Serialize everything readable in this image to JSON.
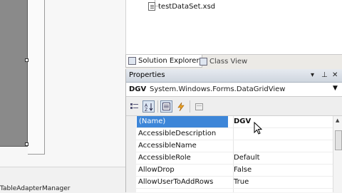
{
  "solution_explorer": {
    "file_name": "testDataSet.xsd",
    "tabs": [
      {
        "label": "Solution Explorer",
        "icon": "solution-explorer-icon"
      },
      {
        "label": "Class View",
        "icon": "class-view-icon"
      }
    ]
  },
  "designer": {
    "tray_item": "TableAdapterManager"
  },
  "properties": {
    "title": "Properties",
    "title_buttons": [
      "▾",
      "⊥",
      "✕"
    ],
    "object_name": "DGV",
    "object_type": "System.Windows.Forms.DataGridView",
    "toolbar_icons": [
      "categorized-icon",
      "alphabetical-icon",
      "properties-icon",
      "events-icon",
      "property-pages-icon"
    ],
    "rows": [
      {
        "name": "(Name)",
        "value": "DGV"
      },
      {
        "name": "AccessibleDescription",
        "value": ""
      },
      {
        "name": "AccessibleName",
        "value": ""
      },
      {
        "name": "AccessibleRole",
        "value": "Default"
      },
      {
        "name": "AllowDrop",
        "value": "False"
      },
      {
        "name": "AllowUserToAddRows",
        "value": "True"
      }
    ]
  },
  "colors": {
    "selection": "#3d86d8",
    "title_bar": "#cfd6df"
  }
}
